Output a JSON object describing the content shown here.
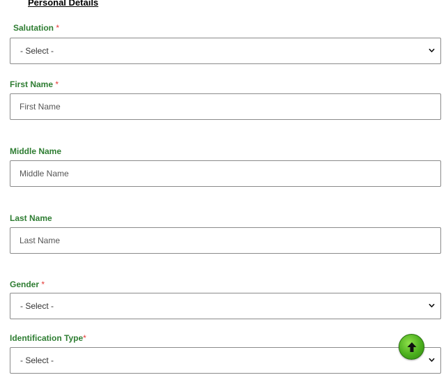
{
  "section": {
    "title": "Personal Details"
  },
  "required_marker": "*",
  "fields": {
    "salutation": {
      "label": "Salutation",
      "required": true,
      "selected": "- Select -"
    },
    "first_name": {
      "label": "First Name",
      "required": true,
      "placeholder": "First Name",
      "value": ""
    },
    "middle_name": {
      "label": "Middle Name",
      "required": false,
      "placeholder": "Middle Name",
      "value": ""
    },
    "last_name": {
      "label": "Last Name",
      "required": false,
      "placeholder": "Last Name",
      "value": ""
    },
    "gender": {
      "label": "Gender",
      "required": true,
      "selected": "- Select -"
    },
    "identification_type": {
      "label": "Identification Type",
      "required": true,
      "selected": "- Select -"
    }
  },
  "icons": {
    "dropdown": "chevron-down-icon",
    "scroll_top": "arrow-up-icon"
  },
  "colors": {
    "label": "#2e7d32",
    "required": "#e53935",
    "border": "#8a8a8a",
    "scroll_button": "#4caf1e"
  }
}
